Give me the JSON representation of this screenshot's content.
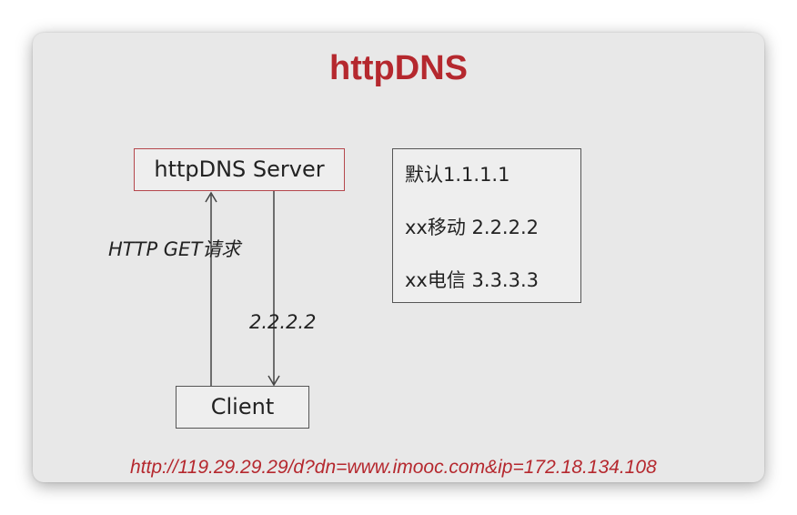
{
  "title": "httpDNS",
  "server": {
    "label": "httpDNS Server"
  },
  "client": {
    "label": "Client"
  },
  "request_label": "HTTP GET请求",
  "response_label": "2.2.2.2",
  "mapping": {
    "lines": [
      "默认1.1.1.1",
      "xx移动 2.2.2.2",
      "xx电信 3.3.3.3"
    ]
  },
  "url": "http://119.29.29.29/d?dn=www.imooc.com&ip=172.18.134.108",
  "colors": {
    "accent": "#b5282e",
    "background": "#e8e8e8"
  }
}
